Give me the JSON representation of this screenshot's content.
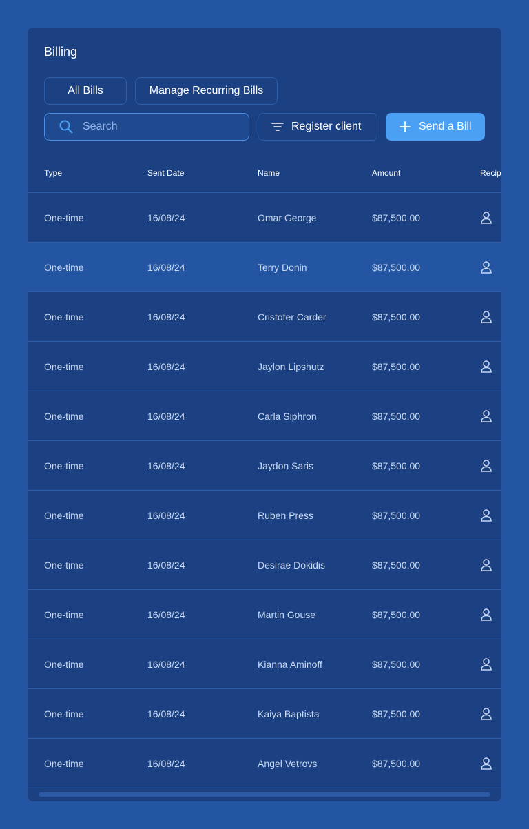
{
  "page": {
    "title": "Billing"
  },
  "tabs": {
    "all_bills": "All Bills",
    "manage_recurring": "Manage Recurring Bills"
  },
  "toolbar": {
    "search_placeholder": "Search",
    "register_label": "Register client",
    "send_label": "Send a Bill"
  },
  "table": {
    "headers": {
      "type": "Type",
      "sent_date": "Sent Date",
      "name": "Name",
      "amount": "Amount",
      "recipient": "Recipient"
    },
    "rows": [
      {
        "type": "One-time",
        "date": "16/08/24",
        "name": "Omar George",
        "amount": "$87,500.00"
      },
      {
        "type": "One-time",
        "date": "16/08/24",
        "name": "Terry Donin",
        "amount": "$87,500.00"
      },
      {
        "type": "One-time",
        "date": "16/08/24",
        "name": "Cristofer Carder",
        "amount": "$87,500.00"
      },
      {
        "type": "One-time",
        "date": "16/08/24",
        "name": "Jaylon Lipshutz",
        "amount": "$87,500.00"
      },
      {
        "type": "One-time",
        "date": "16/08/24",
        "name": "Carla Siphron",
        "amount": "$87,500.00"
      },
      {
        "type": "One-time",
        "date": "16/08/24",
        "name": "Jaydon Saris",
        "amount": "$87,500.00"
      },
      {
        "type": "One-time",
        "date": "16/08/24",
        "name": "Ruben Press",
        "amount": "$87,500.00"
      },
      {
        "type": "One-time",
        "date": "16/08/24",
        "name": "Desirae Dokidis",
        "amount": "$87,500.00"
      },
      {
        "type": "One-time",
        "date": "16/08/24",
        "name": "Martin Gouse",
        "amount": "$87,500.00"
      },
      {
        "type": "One-time",
        "date": "16/08/24",
        "name": "Kianna Aminoff",
        "amount": "$87,500.00"
      },
      {
        "type": "One-time",
        "date": "16/08/24",
        "name": "Kaiya Baptista",
        "amount": "$87,500.00"
      },
      {
        "type": "One-time",
        "date": "16/08/24",
        "name": "Angel Vetrovs",
        "amount": "$87,500.00"
      }
    ],
    "highlighted_row_index": 1
  },
  "icons": {
    "search": "search-icon",
    "filter": "filter-icon",
    "plus": "plus-icon",
    "recipient": "user-icon"
  },
  "colors": {
    "background": "#2355a2",
    "card": "#1c4182",
    "accent": "#4aa0f5",
    "highlight_row": "#2355a2",
    "border": "#2f5ea8"
  }
}
